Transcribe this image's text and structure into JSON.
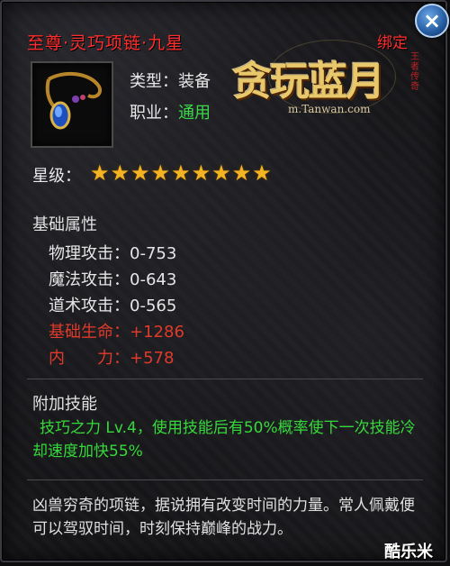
{
  "item": {
    "name": "至尊·灵巧项链·九星",
    "bound_label": "绑定",
    "type_label": "类型：装备",
    "job_label": "职业：",
    "job_value": "通用",
    "stars_label": "星级：",
    "stars": 9
  },
  "logo": {
    "main": "贪玩蓝月",
    "url": "m.Tanwan.com",
    "seal": "王者传奇"
  },
  "base_attrs": {
    "heading": "基础属性",
    "rows": [
      {
        "text": "物理攻击：0-753",
        "color": "white"
      },
      {
        "text": "魔法攻击：0-643",
        "color": "white"
      },
      {
        "text": "道术攻击：0-565",
        "color": "white"
      },
      {
        "text": "基础生命：+1286",
        "color": "red"
      },
      {
        "text": "内　　力：+578",
        "color": "red"
      }
    ]
  },
  "skill": {
    "heading": "附加技能",
    "text": "技巧之力 Lv.4，使用技能后有50%概率使下一次技能冷却速度加快55%"
  },
  "description": "凶兽穷奇的项链，据说拥有改变时间的力量。常人佩戴便可以驾驭时间，时刻保持巅峰的战力。",
  "watermark": "酷乐米",
  "close_glyph": "×"
}
